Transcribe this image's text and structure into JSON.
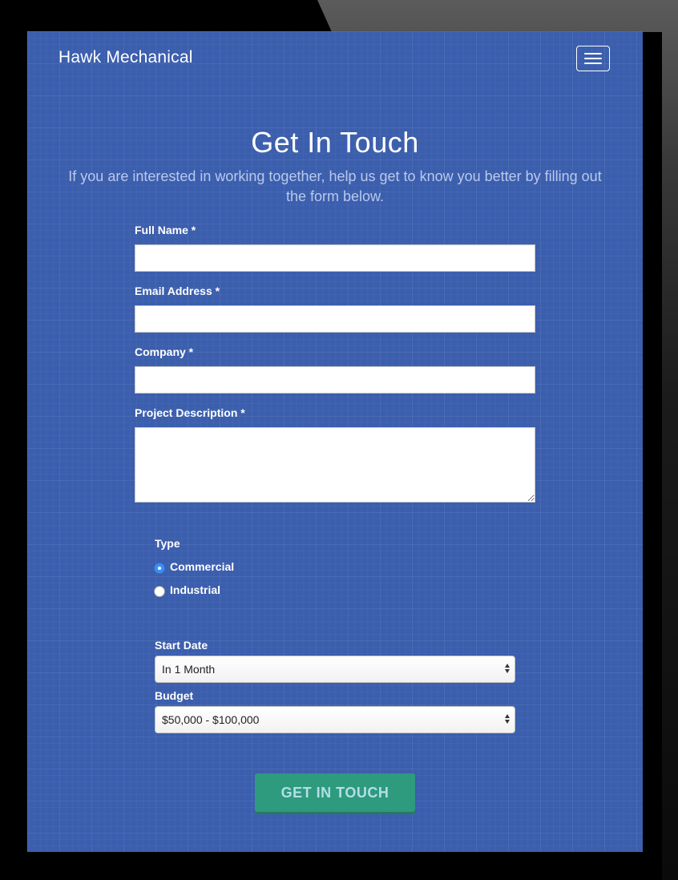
{
  "header": {
    "brand": "Hawk Mechanical",
    "menu_icon": "hamburger-menu-icon"
  },
  "hero": {
    "title": "Get In Touch",
    "subtitle": "If you are interested in working together, help us get to know you better by filling out the form below."
  },
  "form": {
    "full_name_label": "Full Name *",
    "full_name_value": "",
    "email_label": "Email Address *",
    "email_value": "",
    "company_label": "Company *",
    "company_value": "",
    "description_label": "Project Description *",
    "description_value": "",
    "type_label": "Type",
    "type_options": [
      {
        "label": "Commercial",
        "checked": true
      },
      {
        "label": "Industrial",
        "checked": false
      }
    ],
    "start_date_label": "Start Date",
    "start_date_value": "In 1 Month",
    "budget_label": "Budget",
    "budget_value": "$50,000 - $100,000",
    "submit_label": "GET IN TOUCH"
  },
  "colors": {
    "background": "#3b5ead",
    "submit_button": "#2e9a7e",
    "radio_checked": "#3d8ef0"
  }
}
